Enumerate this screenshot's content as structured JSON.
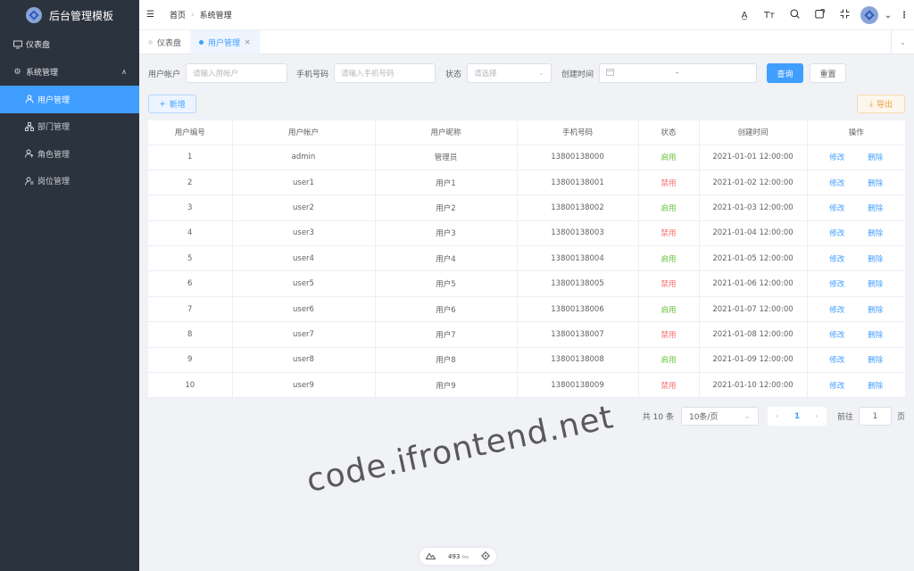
{
  "app": {
    "title": "后台管理模板"
  },
  "sidebar": {
    "dashboard": "仪表盘",
    "system": "系统管理",
    "items": [
      {
        "label": "用户管理",
        "icon": "user-icon"
      },
      {
        "label": "部门管理",
        "icon": "department-icon"
      },
      {
        "label": "角色管理",
        "icon": "role-icon"
      },
      {
        "label": "岗位管理",
        "icon": "post-icon"
      }
    ]
  },
  "header": {
    "breadcrumb": [
      "首页",
      "系统管理"
    ],
    "icons": [
      "translate-icon",
      "font-size-icon",
      "search-icon",
      "fullscreen-icon",
      "expand-icon",
      "more-icon"
    ]
  },
  "tabs": [
    {
      "label": "仪表盘"
    },
    {
      "label": "用户管理"
    }
  ],
  "filter": {
    "account_label": "用户帐户",
    "account_placeholder": "请输入用帐户",
    "phone_label": "手机号码",
    "phone_placeholder": "请输入手机号码",
    "status_label": "状态",
    "status_placeholder": "请选择",
    "time_label": "创建时间",
    "time_sep": "-",
    "query": "查询",
    "reset": "重置"
  },
  "toolbar": {
    "add": "新增",
    "export": "导出"
  },
  "table": {
    "headers": [
      "用户编号",
      "用户帐户",
      "用户昵称",
      "手机号码",
      "状态",
      "创建时间",
      "操作"
    ],
    "edit_label": "修改",
    "delete_label": "删除",
    "rows": [
      {
        "id": "1",
        "account": "admin",
        "nickname": "管理员",
        "phone": "13800138000",
        "status": "启用",
        "created": "2021-01-01 12:00:00"
      },
      {
        "id": "2",
        "account": "user1",
        "nickname": "用户1",
        "phone": "13800138001",
        "status": "禁用",
        "created": "2021-01-02 12:00:00"
      },
      {
        "id": "3",
        "account": "user2",
        "nickname": "用户2",
        "phone": "13800138002",
        "status": "启用",
        "created": "2021-01-03 12:00:00"
      },
      {
        "id": "4",
        "account": "user3",
        "nickname": "用户3",
        "phone": "13800138003",
        "status": "禁用",
        "created": "2021-01-04 12:00:00"
      },
      {
        "id": "5",
        "account": "user4",
        "nickname": "用户4",
        "phone": "13800138004",
        "status": "启用",
        "created": "2021-01-05 12:00:00"
      },
      {
        "id": "6",
        "account": "user5",
        "nickname": "用户5",
        "phone": "13800138005",
        "status": "禁用",
        "created": "2021-01-06 12:00:00"
      },
      {
        "id": "7",
        "account": "user6",
        "nickname": "用户6",
        "phone": "13800138006",
        "status": "启用",
        "created": "2021-01-07 12:00:00"
      },
      {
        "id": "8",
        "account": "user7",
        "nickname": "用户7",
        "phone": "13800138007",
        "status": "禁用",
        "created": "2021-01-08 12:00:00"
      },
      {
        "id": "9",
        "account": "user8",
        "nickname": "用户8",
        "phone": "13800138008",
        "status": "启用",
        "created": "2021-01-09 12:00:00"
      },
      {
        "id": "10",
        "account": "user9",
        "nickname": "用户9",
        "phone": "13800138009",
        "status": "禁用",
        "created": "2021-01-10 12:00:00"
      }
    ]
  },
  "pagination": {
    "total": "共 10 条",
    "page_size": "10条/页",
    "current": "1",
    "goto_label": "前往",
    "goto_value": "1",
    "page_unit": "页"
  },
  "watermark": "code.ifrontend.net",
  "perf": {
    "value": "493",
    "unit": "ms"
  },
  "colors": {
    "primary": "#409eff",
    "sidebar": "#2b333e",
    "enabled": "#67c23a",
    "disabled": "#f56c6c",
    "warning": "#e6a23c"
  }
}
